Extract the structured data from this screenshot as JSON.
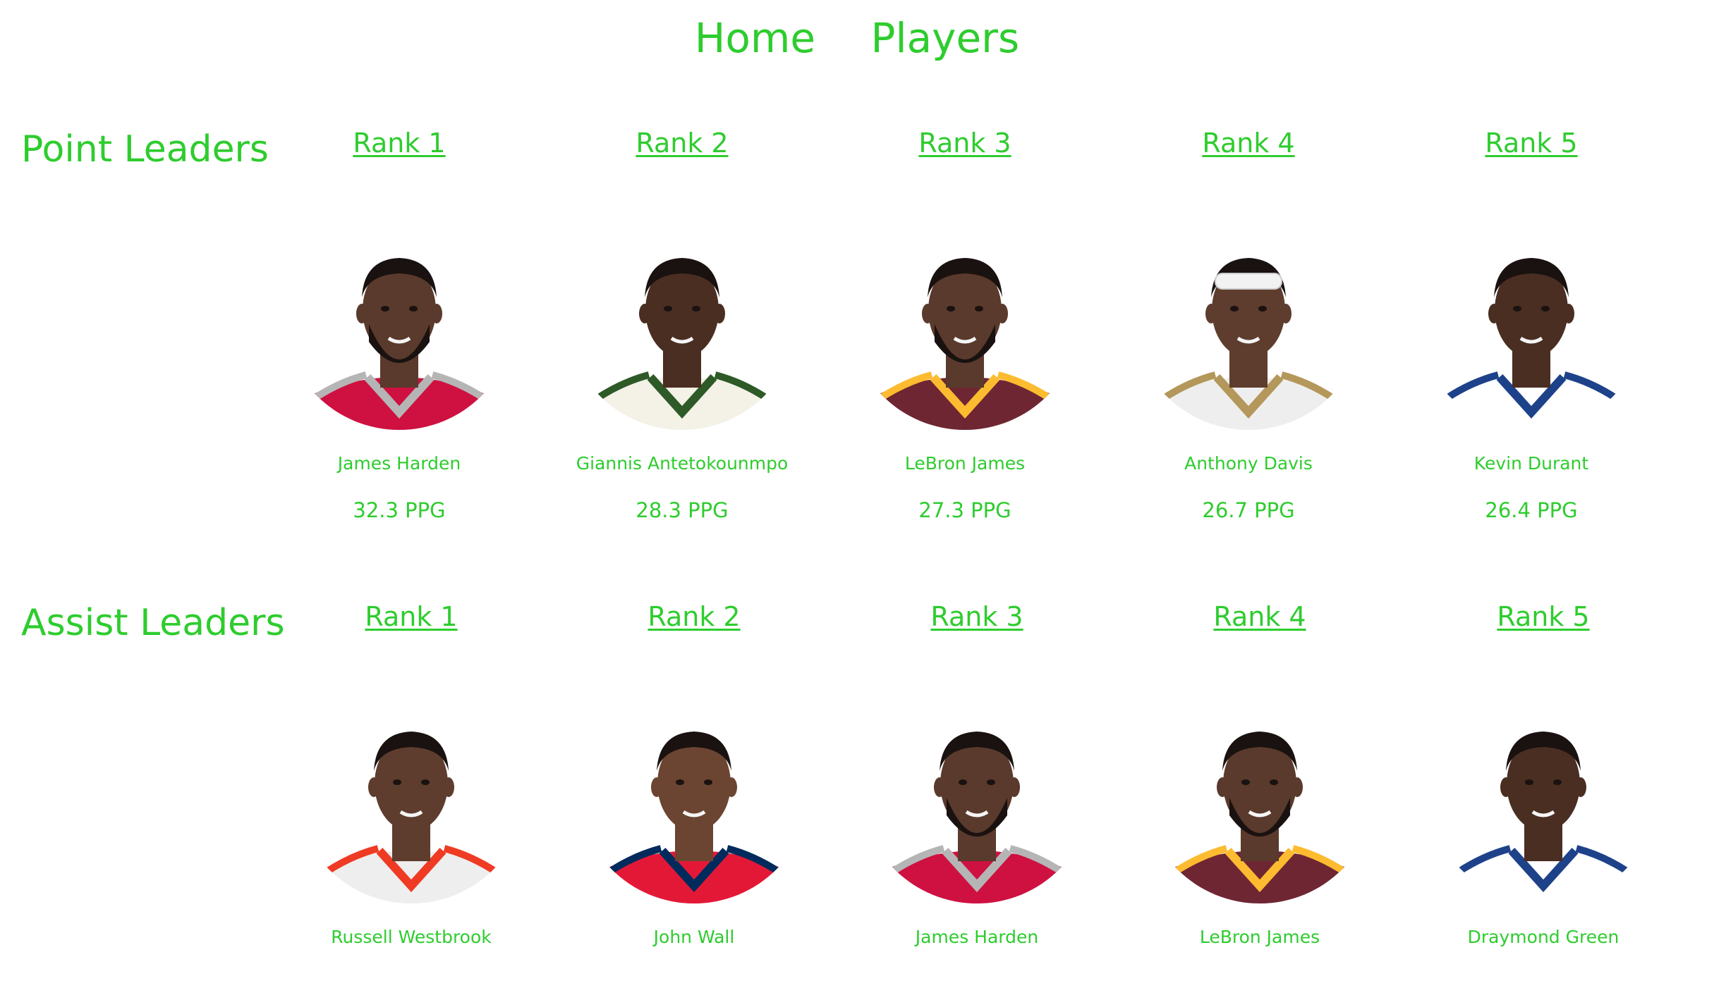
{
  "nav": {
    "home_label": "Home",
    "players_label": "Players"
  },
  "point_leaders": {
    "title": "Point Leaders",
    "players": [
      {
        "rank": "Rank 1",
        "name": "James Harden",
        "stat": "32.3 PPG",
        "jersey": "#ce1141",
        "trim": "#b5b5b5",
        "skin": "#5a3a2c",
        "beard": true,
        "headband": false
      },
      {
        "rank": "Rank 2",
        "name": "Giannis Antetokounmpo",
        "stat": "28.3 PPG",
        "jersey": "#f4f1e6",
        "trim": "#2d5a27",
        "skin": "#4a2e22",
        "beard": false,
        "headband": false
      },
      {
        "rank": "Rank 3",
        "name": "LeBron James",
        "stat": "27.3 PPG",
        "jersey": "#6f2633",
        "trim": "#fdbb30",
        "skin": "#5a3a2c",
        "beard": true,
        "headband": false
      },
      {
        "rank": "Rank 4",
        "name": "Anthony Davis",
        "stat": "26.7 PPG",
        "jersey": "#eeeeee",
        "trim": "#b4975a",
        "skin": "#5e3d2e",
        "beard": false,
        "headband": true
      },
      {
        "rank": "Rank 5",
        "name": "Kevin Durant",
        "stat": "26.4 PPG",
        "jersey": "#ffffff",
        "trim": "#1d428a",
        "skin": "#4a2e22",
        "beard": false,
        "headband": false
      }
    ]
  },
  "assist_leaders": {
    "title": "Assist Leaders",
    "players": [
      {
        "rank": "Rank 1",
        "name": "Russell Westbrook",
        "stat": "",
        "jersey": "#eeeeee",
        "trim": "#ef3b24",
        "skin": "#5e3d2e",
        "beard": false,
        "headband": false
      },
      {
        "rank": "Rank 2",
        "name": "John Wall",
        "stat": "",
        "jersey": "#e31837",
        "trim": "#002b5c",
        "skin": "#6b4532",
        "beard": false,
        "headband": false
      },
      {
        "rank": "Rank 3",
        "name": "James Harden",
        "stat": "",
        "jersey": "#ce1141",
        "trim": "#b5b5b5",
        "skin": "#5a3a2c",
        "beard": true,
        "headband": false
      },
      {
        "rank": "Rank 4",
        "name": "LeBron James",
        "stat": "",
        "jersey": "#6f2633",
        "trim": "#fdbb30",
        "skin": "#5a3a2c",
        "beard": true,
        "headband": false
      },
      {
        "rank": "Rank 5",
        "name": "Draymond Green",
        "stat": "",
        "jersey": "#ffffff",
        "trim": "#1d428a",
        "skin": "#4a2e22",
        "beard": false,
        "headband": false
      }
    ]
  },
  "colors": {
    "accent": "#2ecc2e",
    "background": "#ffffff"
  }
}
